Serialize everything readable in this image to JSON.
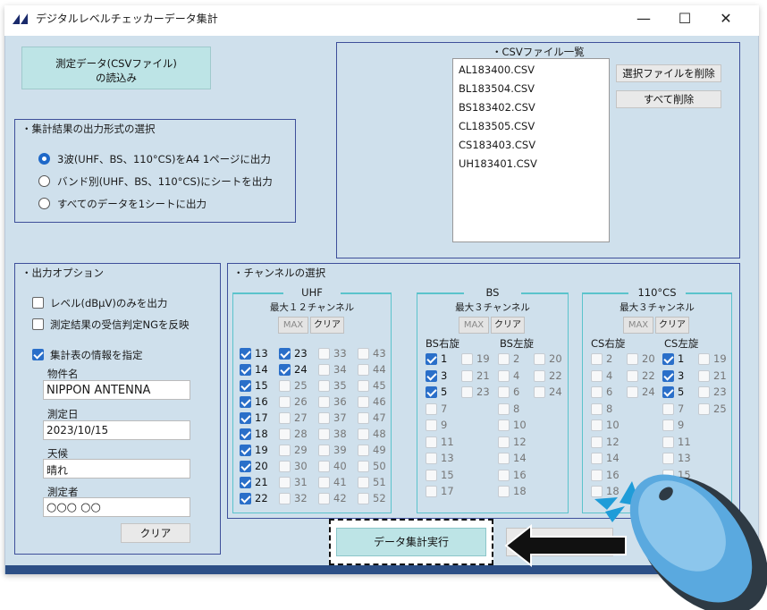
{
  "window": {
    "title": "デジタルレベルチェッカーデータ集計",
    "minimize": "—",
    "maximize": "☐",
    "close": "✕"
  },
  "load_button": {
    "line1": "測定データ(CSVファイル)",
    "line2": "の読込み"
  },
  "output_format": {
    "title": "・集計結果の出力形式の選択",
    "options": [
      {
        "label": "3波(UHF、BS、110°CS)をA4 1ページに出力",
        "selected": true
      },
      {
        "label": "バンド別(UHF、BS、110°CS)にシートを出力",
        "selected": false
      },
      {
        "label": "すべてのデータを1シートに出力",
        "selected": false
      }
    ]
  },
  "csv_list": {
    "title": "・CSVファイル一覧",
    "files": [
      "AL183400.CSV",
      "BL183504.CSV",
      "BS183402.CSV",
      "CL183505.CSV",
      "CS183403.CSV",
      "UH183401.CSV"
    ],
    "delete_selected": "選択ファイルを削除",
    "delete_all": "すべて削除"
  },
  "output_options": {
    "title": "・出力オプション",
    "level_only": {
      "label": "レベル(dBμV)のみを出力",
      "checked": false
    },
    "ng_reflect": {
      "label": "測定結果の受信判定NGを反映",
      "checked": false
    },
    "specify_info": {
      "label": "集計表の情報を指定",
      "checked": true
    },
    "property_label": "物件名",
    "property_value": "NIPPON ANTENNA",
    "date_label": "測定日",
    "date_value": "2023/10/15",
    "weather_label": "天候",
    "weather_value": "晴れ",
    "operator_label": "測定者",
    "operator_value": "○○○ ○○",
    "clear": "クリア"
  },
  "channels": {
    "title": "・チャンネルの選択",
    "uhf": {
      "title": "UHF",
      "max_label": "最大１２チャンネル",
      "max_btn": "MAX",
      "clear_btn": "クリア",
      "columns": [
        [
          {
            "n": "13",
            "c": true
          },
          {
            "n": "14",
            "c": true
          },
          {
            "n": "15",
            "c": true
          },
          {
            "n": "16",
            "c": true
          },
          {
            "n": "17",
            "c": true
          },
          {
            "n": "18",
            "c": true
          },
          {
            "n": "19",
            "c": true
          },
          {
            "n": "20",
            "c": true
          },
          {
            "n": "21",
            "c": true
          },
          {
            "n": "22",
            "c": true
          }
        ],
        [
          {
            "n": "23",
            "c": true
          },
          {
            "n": "24",
            "c": true
          },
          {
            "n": "25",
            "c": false
          },
          {
            "n": "26",
            "c": false
          },
          {
            "n": "27",
            "c": false
          },
          {
            "n": "28",
            "c": false
          },
          {
            "n": "29",
            "c": false
          },
          {
            "n": "30",
            "c": false
          },
          {
            "n": "31",
            "c": false
          },
          {
            "n": "32",
            "c": false
          }
        ],
        [
          {
            "n": "33",
            "c": false
          },
          {
            "n": "34",
            "c": false
          },
          {
            "n": "35",
            "c": false
          },
          {
            "n": "36",
            "c": false
          },
          {
            "n": "37",
            "c": false
          },
          {
            "n": "38",
            "c": false
          },
          {
            "n": "39",
            "c": false
          },
          {
            "n": "40",
            "c": false
          },
          {
            "n": "41",
            "c": false
          },
          {
            "n": "42",
            "c": false
          }
        ],
        [
          {
            "n": "43",
            "c": false
          },
          {
            "n": "44",
            "c": false
          },
          {
            "n": "45",
            "c": false
          },
          {
            "n": "46",
            "c": false
          },
          {
            "n": "47",
            "c": false
          },
          {
            "n": "48",
            "c": false
          },
          {
            "n": "49",
            "c": false
          },
          {
            "n": "50",
            "c": false
          },
          {
            "n": "51",
            "c": false
          },
          {
            "n": "52",
            "c": false
          }
        ]
      ]
    },
    "bs": {
      "title": "BS",
      "max_label": "最大３チャンネル",
      "max_btn": "MAX",
      "clear_btn": "クリア",
      "right_label": "BS右旋",
      "left_label": "BS左旋",
      "columns": [
        [
          {
            "n": "1",
            "c": true
          },
          {
            "n": "3",
            "c": true
          },
          {
            "n": "5",
            "c": true
          },
          {
            "n": "7",
            "c": false
          },
          {
            "n": "9",
            "c": false
          },
          {
            "n": "11",
            "c": false
          },
          {
            "n": "13",
            "c": false
          },
          {
            "n": "15",
            "c": false
          },
          {
            "n": "17",
            "c": false
          }
        ],
        [
          {
            "n": "19",
            "c": false
          },
          {
            "n": "21",
            "c": false
          },
          {
            "n": "23",
            "c": false
          }
        ],
        [
          {
            "n": "2",
            "c": false
          },
          {
            "n": "4",
            "c": false
          },
          {
            "n": "6",
            "c": false
          },
          {
            "n": "8",
            "c": false
          },
          {
            "n": "10",
            "c": false
          },
          {
            "n": "12",
            "c": false
          },
          {
            "n": "14",
            "c": false
          },
          {
            "n": "16",
            "c": false
          },
          {
            "n": "18",
            "c": false
          }
        ],
        [
          {
            "n": "20",
            "c": false
          },
          {
            "n": "22",
            "c": false
          },
          {
            "n": "24",
            "c": false
          }
        ]
      ]
    },
    "cs": {
      "title": "110°CS",
      "max_label": "最大３チャンネル",
      "max_btn": "MAX",
      "clear_btn": "クリア",
      "right_label": "CS右旋",
      "left_label": "CS左旋",
      "columns": [
        [
          {
            "n": "2",
            "c": false
          },
          {
            "n": "4",
            "c": false
          },
          {
            "n": "6",
            "c": false
          },
          {
            "n": "8",
            "c": false
          },
          {
            "n": "10",
            "c": false
          },
          {
            "n": "12",
            "c": false
          },
          {
            "n": "14",
            "c": false
          },
          {
            "n": "16",
            "c": false
          },
          {
            "n": "18",
            "c": false
          }
        ],
        [
          {
            "n": "20",
            "c": false
          },
          {
            "n": "22",
            "c": false
          },
          {
            "n": "24",
            "c": false
          }
        ],
        [
          {
            "n": "1",
            "c": true
          },
          {
            "n": "3",
            "c": true
          },
          {
            "n": "5",
            "c": true
          },
          {
            "n": "7",
            "c": false
          },
          {
            "n": "9",
            "c": false
          },
          {
            "n": "11",
            "c": false
          },
          {
            "n": "13",
            "c": false
          },
          {
            "n": "15",
            "c": false
          }
        ],
        [
          {
            "n": "19",
            "c": false
          },
          {
            "n": "21",
            "c": false
          },
          {
            "n": "23",
            "c": false
          },
          {
            "n": "25",
            "c": false
          }
        ]
      ]
    }
  },
  "execute": {
    "label": "データ集計実行"
  },
  "colors": {
    "client_bg": "#cfe0ec",
    "accent": "#2a6fc9",
    "execute_bg": "#bde4e6",
    "group_line": "#5bc3cc"
  }
}
